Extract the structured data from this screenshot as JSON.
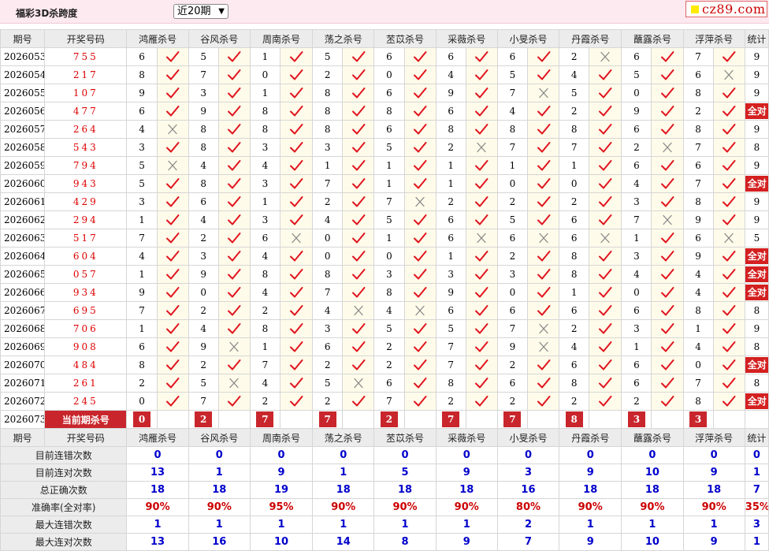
{
  "header": {
    "title": "福彩3D杀跨度",
    "select_value": "近20期",
    "logo_text": "cz89.com"
  },
  "columns": {
    "period": "期号",
    "numbers": "开奖号码",
    "experts": [
      "鸿雁杀号",
      "谷风杀号",
      "周南杀号",
      "荡之杀号",
      "苤苡杀号",
      "采薇杀号",
      "小旻杀号",
      "丹霞杀号",
      "蘸露杀号",
      "浮萍杀号"
    ],
    "stats": "统计"
  },
  "icons": {
    "right": "check-icon",
    "wrong": "cross-icon"
  },
  "colors": {
    "check": "#e0141e",
    "cross": "#888888",
    "accent": "#c8262c",
    "value_blue": "#0000cc"
  },
  "rows": [
    {
      "period": "2026053",
      "numbers": "755",
      "picks": [
        [
          6,
          1
        ],
        [
          5,
          1
        ],
        [
          1,
          1
        ],
        [
          5,
          1
        ],
        [
          6,
          1
        ],
        [
          6,
          1
        ],
        [
          6,
          1
        ],
        [
          2,
          0
        ],
        [
          6,
          1
        ],
        [
          7,
          1
        ]
      ],
      "stat": "9"
    },
    {
      "period": "2026054",
      "numbers": "217",
      "picks": [
        [
          8,
          1
        ],
        [
          7,
          1
        ],
        [
          0,
          1
        ],
        [
          2,
          1
        ],
        [
          0,
          1
        ],
        [
          4,
          1
        ],
        [
          5,
          1
        ],
        [
          4,
          1
        ],
        [
          5,
          1
        ],
        [
          6,
          0
        ]
      ],
      "stat": "9"
    },
    {
      "period": "2026055",
      "numbers": "107",
      "picks": [
        [
          9,
          1
        ],
        [
          3,
          1
        ],
        [
          1,
          1
        ],
        [
          8,
          1
        ],
        [
          6,
          1
        ],
        [
          9,
          1
        ],
        [
          7,
          0
        ],
        [
          5,
          1
        ],
        [
          0,
          1
        ],
        [
          8,
          1
        ]
      ],
      "stat": "9"
    },
    {
      "period": "2026056",
      "numbers": "477",
      "picks": [
        [
          6,
          1
        ],
        [
          9,
          1
        ],
        [
          8,
          1
        ],
        [
          8,
          1
        ],
        [
          8,
          1
        ],
        [
          6,
          1
        ],
        [
          4,
          1
        ],
        [
          2,
          1
        ],
        [
          9,
          1
        ],
        [
          2,
          1
        ]
      ],
      "stat": "全对"
    },
    {
      "period": "2026057",
      "numbers": "264",
      "picks": [
        [
          4,
          0
        ],
        [
          8,
          1
        ],
        [
          8,
          1
        ],
        [
          8,
          1
        ],
        [
          6,
          1
        ],
        [
          8,
          1
        ],
        [
          8,
          1
        ],
        [
          8,
          1
        ],
        [
          6,
          1
        ],
        [
          8,
          1
        ]
      ],
      "stat": "9"
    },
    {
      "period": "2026058",
      "numbers": "543",
      "picks": [
        [
          3,
          1
        ],
        [
          8,
          1
        ],
        [
          3,
          1
        ],
        [
          3,
          1
        ],
        [
          5,
          1
        ],
        [
          2,
          0
        ],
        [
          7,
          1
        ],
        [
          7,
          1
        ],
        [
          2,
          0
        ],
        [
          7,
          1
        ]
      ],
      "stat": "8"
    },
    {
      "period": "2026059",
      "numbers": "794",
      "picks": [
        [
          5,
          0
        ],
        [
          4,
          1
        ],
        [
          4,
          1
        ],
        [
          1,
          1
        ],
        [
          1,
          1
        ],
        [
          1,
          1
        ],
        [
          1,
          1
        ],
        [
          1,
          1
        ],
        [
          6,
          1
        ],
        [
          6,
          1
        ]
      ],
      "stat": "9"
    },
    {
      "period": "2026060",
      "numbers": "943",
      "picks": [
        [
          5,
          1
        ],
        [
          8,
          1
        ],
        [
          3,
          1
        ],
        [
          7,
          1
        ],
        [
          1,
          1
        ],
        [
          1,
          1
        ],
        [
          0,
          1
        ],
        [
          0,
          1
        ],
        [
          4,
          1
        ],
        [
          7,
          1
        ]
      ],
      "stat": "全对"
    },
    {
      "period": "2026061",
      "numbers": "429",
      "picks": [
        [
          3,
          1
        ],
        [
          6,
          1
        ],
        [
          1,
          1
        ],
        [
          2,
          1
        ],
        [
          7,
          0
        ],
        [
          2,
          1
        ],
        [
          2,
          1
        ],
        [
          2,
          1
        ],
        [
          3,
          1
        ],
        [
          8,
          1
        ]
      ],
      "stat": "9"
    },
    {
      "period": "2026062",
      "numbers": "294",
      "picks": [
        [
          1,
          1
        ],
        [
          4,
          1
        ],
        [
          3,
          1
        ],
        [
          4,
          1
        ],
        [
          5,
          1
        ],
        [
          6,
          1
        ],
        [
          5,
          1
        ],
        [
          6,
          1
        ],
        [
          7,
          0
        ],
        [
          9,
          1
        ]
      ],
      "stat": "9"
    },
    {
      "period": "2026063",
      "numbers": "517",
      "picks": [
        [
          7,
          1
        ],
        [
          2,
          1
        ],
        [
          6,
          0
        ],
        [
          0,
          1
        ],
        [
          1,
          1
        ],
        [
          6,
          0
        ],
        [
          6,
          0
        ],
        [
          6,
          0
        ],
        [
          1,
          1
        ],
        [
          6,
          0
        ]
      ],
      "stat": "5"
    },
    {
      "period": "2026064",
      "numbers": "604",
      "picks": [
        [
          4,
          1
        ],
        [
          3,
          1
        ],
        [
          4,
          1
        ],
        [
          0,
          1
        ],
        [
          0,
          1
        ],
        [
          1,
          1
        ],
        [
          2,
          1
        ],
        [
          8,
          1
        ],
        [
          3,
          1
        ],
        [
          9,
          1
        ]
      ],
      "stat": "全对"
    },
    {
      "period": "2026065",
      "numbers": "057",
      "picks": [
        [
          1,
          1
        ],
        [
          9,
          1
        ],
        [
          8,
          1
        ],
        [
          8,
          1
        ],
        [
          3,
          1
        ],
        [
          3,
          1
        ],
        [
          3,
          1
        ],
        [
          8,
          1
        ],
        [
          4,
          1
        ],
        [
          4,
          1
        ]
      ],
      "stat": "全对"
    },
    {
      "period": "2026066",
      "numbers": "934",
      "picks": [
        [
          9,
          1
        ],
        [
          0,
          1
        ],
        [
          4,
          1
        ],
        [
          7,
          1
        ],
        [
          8,
          1
        ],
        [
          9,
          1
        ],
        [
          0,
          1
        ],
        [
          1,
          1
        ],
        [
          0,
          1
        ],
        [
          4,
          1
        ]
      ],
      "stat": "全对"
    },
    {
      "period": "2026067",
      "numbers": "695",
      "picks": [
        [
          7,
          1
        ],
        [
          2,
          1
        ],
        [
          2,
          1
        ],
        [
          4,
          0
        ],
        [
          4,
          0
        ],
        [
          6,
          1
        ],
        [
          6,
          1
        ],
        [
          6,
          1
        ],
        [
          6,
          1
        ],
        [
          8,
          1
        ]
      ],
      "stat": "8"
    },
    {
      "period": "2026068",
      "numbers": "706",
      "picks": [
        [
          1,
          1
        ],
        [
          4,
          1
        ],
        [
          8,
          1
        ],
        [
          3,
          1
        ],
        [
          5,
          1
        ],
        [
          5,
          1
        ],
        [
          7,
          0
        ],
        [
          2,
          1
        ],
        [
          3,
          1
        ],
        [
          1,
          1
        ]
      ],
      "stat": "9"
    },
    {
      "period": "2026069",
      "numbers": "908",
      "picks": [
        [
          6,
          1
        ],
        [
          9,
          0
        ],
        [
          1,
          1
        ],
        [
          6,
          1
        ],
        [
          2,
          1
        ],
        [
          7,
          1
        ],
        [
          9,
          0
        ],
        [
          4,
          1
        ],
        [
          1,
          1
        ],
        [
          4,
          1
        ]
      ],
      "stat": "8"
    },
    {
      "period": "2026070",
      "numbers": "484",
      "picks": [
        [
          8,
          1
        ],
        [
          2,
          1
        ],
        [
          7,
          1
        ],
        [
          2,
          1
        ],
        [
          2,
          1
        ],
        [
          7,
          1
        ],
        [
          2,
          1
        ],
        [
          6,
          1
        ],
        [
          6,
          1
        ],
        [
          0,
          1
        ]
      ],
      "stat": "全对"
    },
    {
      "period": "2026071",
      "numbers": "261",
      "picks": [
        [
          2,
          1
        ],
        [
          5,
          0
        ],
        [
          4,
          1
        ],
        [
          5,
          0
        ],
        [
          6,
          1
        ],
        [
          8,
          1
        ],
        [
          6,
          1
        ],
        [
          8,
          1
        ],
        [
          6,
          1
        ],
        [
          7,
          1
        ]
      ],
      "stat": "8"
    },
    {
      "period": "2026072",
      "numbers": "245",
      "picks": [
        [
          0,
          1
        ],
        [
          7,
          1
        ],
        [
          2,
          1
        ],
        [
          2,
          1
        ],
        [
          7,
          1
        ],
        [
          2,
          1
        ],
        [
          2,
          1
        ],
        [
          2,
          1
        ],
        [
          2,
          1
        ],
        [
          8,
          1
        ]
      ],
      "stat": "全对"
    }
  ],
  "current": {
    "period": "2026073",
    "label": "当前期杀号",
    "kills": [
      "0",
      "2",
      "7",
      "7",
      "2",
      "7",
      "7",
      "8",
      "3",
      "3"
    ]
  },
  "summary": [
    {
      "label": "目前连错次数",
      "values": [
        "0",
        "0",
        "0",
        "0",
        "0",
        "0",
        "0",
        "0",
        "0",
        "0",
        "0"
      ],
      "red": false
    },
    {
      "label": "目前连对次数",
      "values": [
        "13",
        "1",
        "9",
        "1",
        "5",
        "9",
        "3",
        "9",
        "10",
        "9",
        "1"
      ],
      "red": false
    },
    {
      "label": "总正确次数",
      "values": [
        "18",
        "18",
        "19",
        "18",
        "18",
        "18",
        "16",
        "18",
        "18",
        "18",
        "7"
      ],
      "red": false
    },
    {
      "label": "准确率(全对率)",
      "values": [
        "90%",
        "90%",
        "95%",
        "90%",
        "90%",
        "90%",
        "80%",
        "90%",
        "90%",
        "90%",
        "35%"
      ],
      "red": true
    },
    {
      "label": "最大连错次数",
      "values": [
        "1",
        "1",
        "1",
        "1",
        "1",
        "1",
        "2",
        "1",
        "1",
        "1",
        "3"
      ],
      "red": false
    },
    {
      "label": "最大连对次数",
      "values": [
        "13",
        "16",
        "10",
        "14",
        "8",
        "9",
        "7",
        "9",
        "10",
        "9",
        "1"
      ],
      "red": false
    }
  ]
}
